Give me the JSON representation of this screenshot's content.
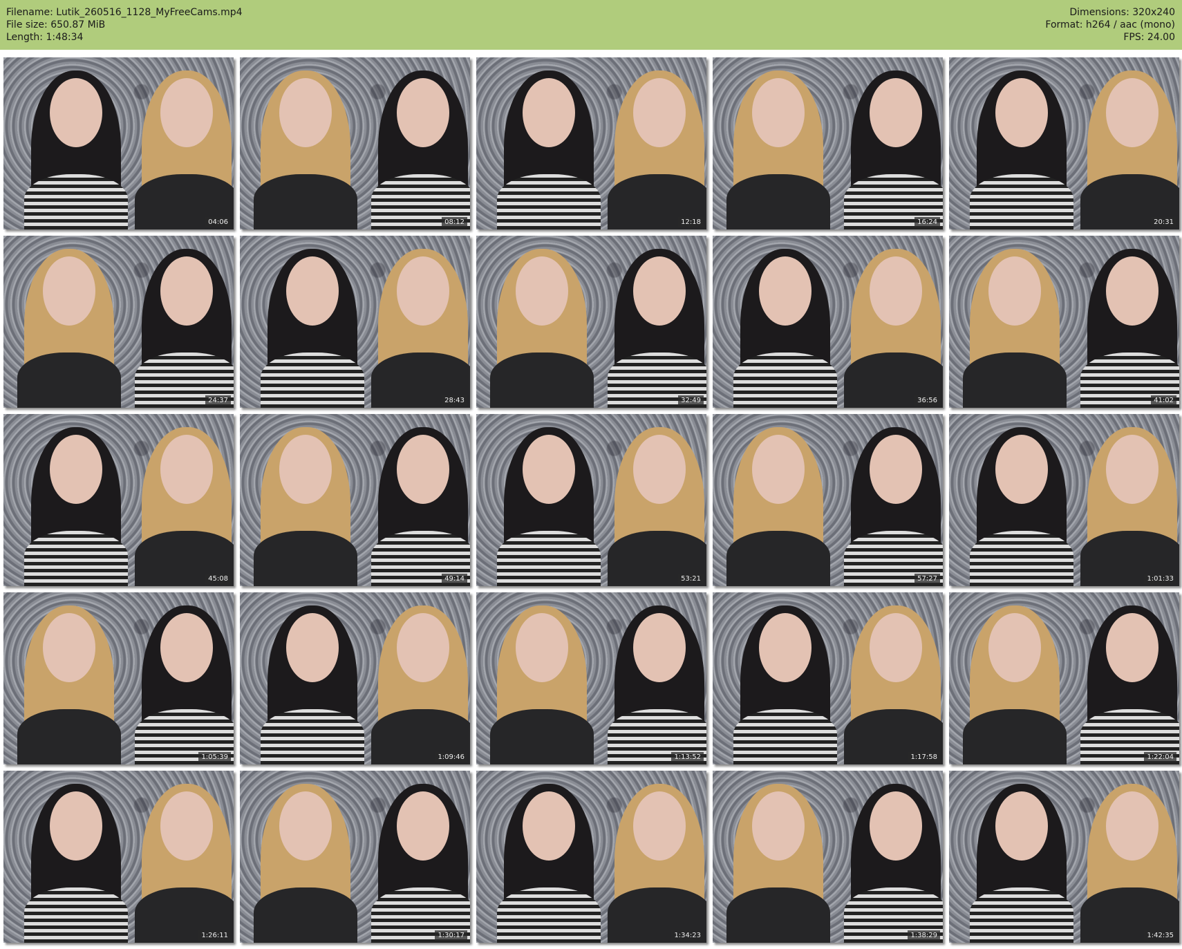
{
  "header": {
    "filename": "Filename: Lutik_260516_1128_MyFreeCams.mp4",
    "filesize": "File size: 650.87 MiB",
    "length": "Length: 1:48:34",
    "dimensions": "Dimensions: 320x240",
    "format": "Format: h264 / aac (mono)",
    "fps": "FPS: 24.00"
  },
  "thumbnails": [
    "04:06",
    "08:12",
    "12:18",
    "16:24",
    "20:31",
    "24:37",
    "28:43",
    "32:49",
    "36:56",
    "41:02",
    "45:08",
    "49:14",
    "53:21",
    "57:27",
    "1:01:33",
    "1:05:39",
    "1:09:46",
    "1:13:52",
    "1:17:58",
    "1:22:04",
    "1:26:11",
    "1:30:17",
    "1:34:23",
    "1:38:29",
    "1:42:35"
  ]
}
